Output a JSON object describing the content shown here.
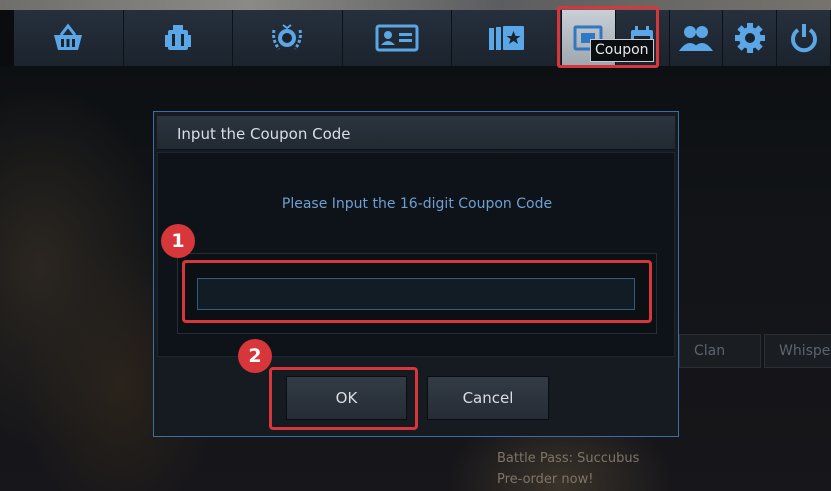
{
  "toolbar": {
    "buttons": [
      {
        "icon": "basket-icon"
      },
      {
        "icon": "inventory-icon"
      },
      {
        "icon": "emblem-icon"
      },
      {
        "icon": "profile-card-icon"
      },
      {
        "icon": "cards-icon"
      },
      {
        "icon": "coupon-icon"
      },
      {
        "icon": "calendar-icon"
      },
      {
        "icon": "friends-icon"
      },
      {
        "icon": "settings-icon"
      },
      {
        "icon": "power-icon"
      }
    ],
    "tooltip": "Coupon"
  },
  "background": {
    "tabs": [
      "Clan",
      "Whisper"
    ],
    "promo_lines": [
      "Battle Pass: Succubus",
      "Pre-order now!"
    ]
  },
  "dialog": {
    "title": "Input the Coupon Code",
    "prompt": "Please Input the 16-digit Coupon Code",
    "input_value": "",
    "ok_label": "OK",
    "cancel_label": "Cancel"
  },
  "annotations": {
    "step1": "1",
    "step2": "2",
    "highlight_color": "#d7363a"
  },
  "colors": {
    "accent_border": "#3b6fa3",
    "prompt_text": "#6f9fd0",
    "icon_color": "#5aa6e6"
  }
}
